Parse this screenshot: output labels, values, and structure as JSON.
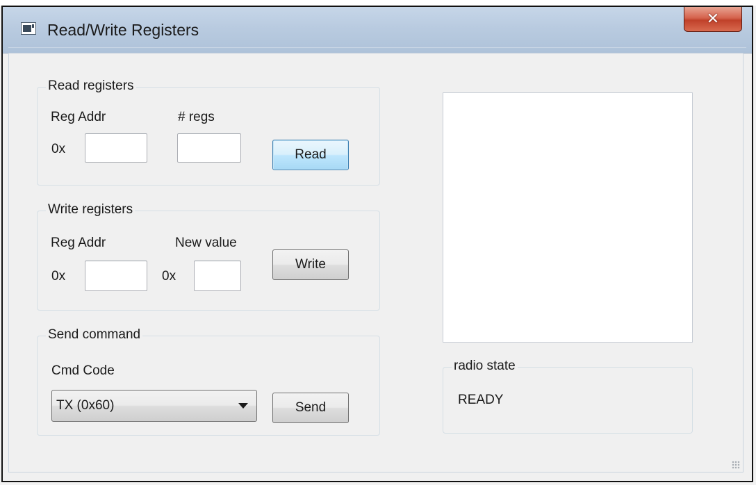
{
  "window": {
    "title": "Read/Write Registers",
    "close_glyph": "✕"
  },
  "read_registers": {
    "group_title": "Read registers",
    "reg_addr_label": "Reg Addr",
    "num_regs_label": "# regs",
    "hex_prefix": "0x",
    "reg_addr_value": "",
    "num_regs_value": "",
    "read_label": "Read"
  },
  "write_registers": {
    "group_title": "Write registers",
    "reg_addr_label": "Reg Addr",
    "new_value_label": "New value",
    "addr_hex_prefix": "0x",
    "value_hex_prefix": "0x",
    "reg_addr_value": "",
    "new_value_value": "",
    "write_label": "Write"
  },
  "send_command": {
    "group_title": "Send command",
    "cmd_code_label": "Cmd Code",
    "cmd_selected": "TX (0x60)",
    "send_label": "Send"
  },
  "output": {
    "text": ""
  },
  "radio_state": {
    "group_title": "radio state",
    "value": "READY"
  },
  "colors": {
    "focused_button_border": "#3c7fb1",
    "close_button": "#c0412a",
    "titlebar": "#b9cbe0"
  },
  "icons": {
    "app": "app-icon",
    "close": "close-icon",
    "dropdown": "chevron-down-icon",
    "resize": "grip-icon"
  }
}
